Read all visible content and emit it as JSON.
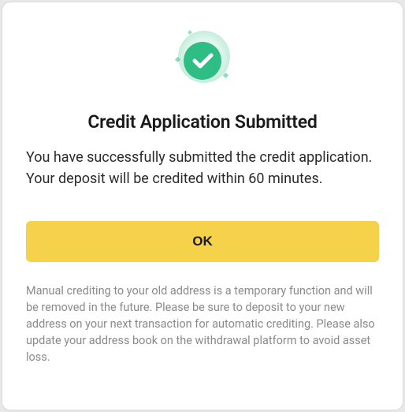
{
  "modal": {
    "title": "Credit Application Submitted",
    "message": "You have successfully submitted the credit application. Your deposit will be credited within 60 minutes.",
    "ok_label": "OK",
    "footnote": "Manual crediting to your old address is a temporary function and will be removed in the future. Please be sure to deposit to your new address on your next transaction for automatic crediting. Please also update your address book on the withdrawal platform to avoid asset loss."
  },
  "colors": {
    "accent": "#f6d24a",
    "success": "#2ebd85"
  }
}
